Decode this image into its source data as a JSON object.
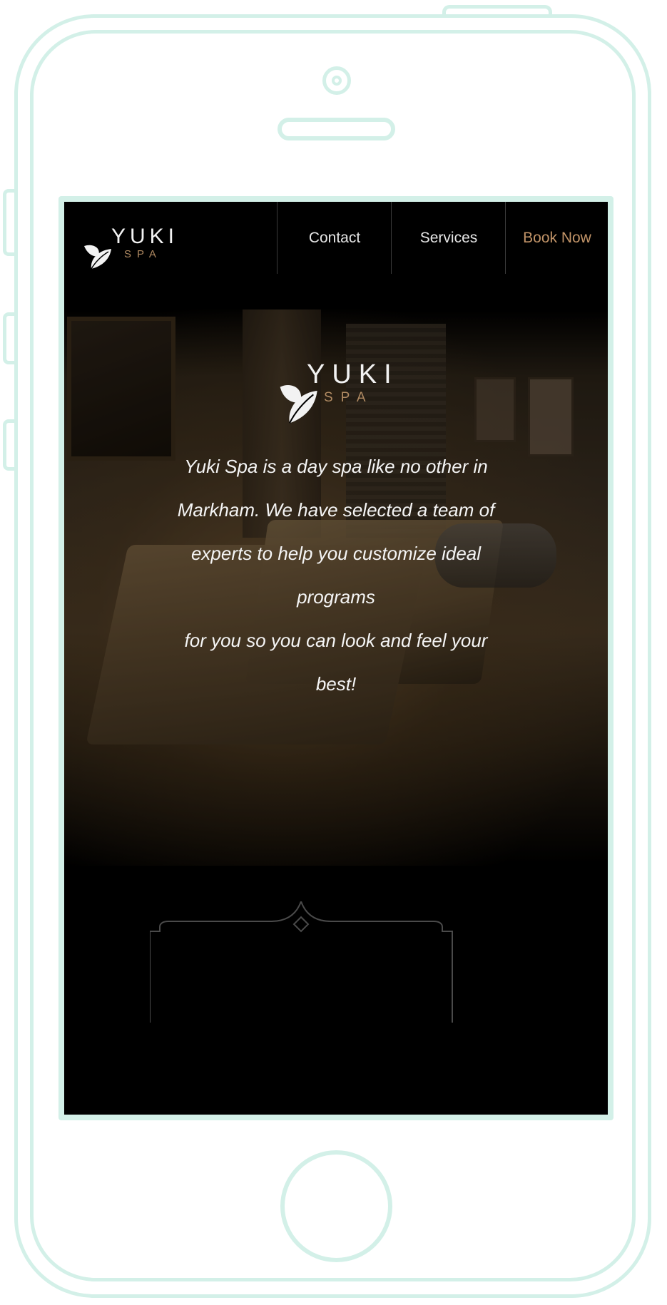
{
  "navbar": {
    "logo_word": "YUKI",
    "logo_sub": "SPA",
    "items": [
      {
        "label": "Contact"
      },
      {
        "label": "Services"
      },
      {
        "label": "Book Now"
      }
    ]
  },
  "hero": {
    "logo_word": "YUKI",
    "logo_sub": "SPA",
    "description": "Yuki Spa is a day spa like no other in\nMarkham. We have selected a team of\nexperts to help you customize ideal\nprograms\nfor you so you can look and feel your\nbest!"
  },
  "colors": {
    "accent": "#c29468",
    "frame": "#d3f0e8",
    "background": "#000000"
  },
  "icons": [
    "leaf-icon",
    "ornament-divider-icon"
  ]
}
